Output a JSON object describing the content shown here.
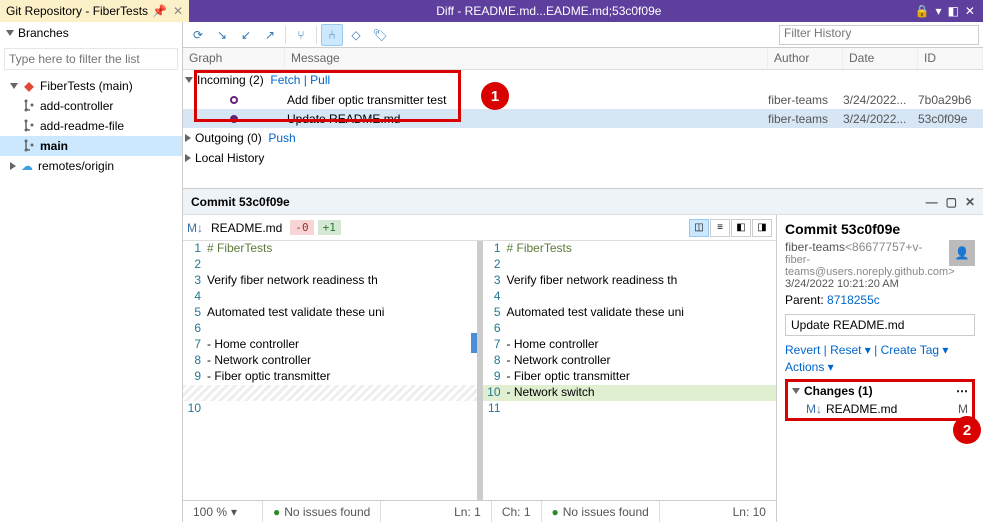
{
  "tab": {
    "title": "Git Repository - FiberTests"
  },
  "window": {
    "diff_title": "Diff - README.md...EADME.md;53c0f09e"
  },
  "branches": {
    "header": "Branches",
    "filter_placeholder": "Type here to filter the list",
    "repo": "FiberTests (main)",
    "items": [
      "add-controller",
      "add-readme-file",
      "main"
    ],
    "remote": "remotes/origin"
  },
  "history": {
    "filter_placeholder": "Filter History",
    "cols": {
      "graph": "Graph",
      "msg": "Message",
      "auth": "Author",
      "date": "Date",
      "id": "ID"
    },
    "incoming_label": "Incoming (2)",
    "incoming_links": "Fetch | Pull",
    "outgoing_label": "Outgoing (0)",
    "outgoing_link": "Push",
    "local_label": "Local History",
    "rows": [
      {
        "msg": "Add fiber optic transmitter test",
        "auth": "fiber-teams",
        "date": "3/24/2022...",
        "id": "7b0a29b6"
      },
      {
        "msg": "Update README.md",
        "auth": "fiber-teams",
        "date": "3/24/2022...",
        "id": "53c0f09e"
      }
    ]
  },
  "detail": {
    "header": "Commit 53c0f09e",
    "file": "README.md",
    "removed": "-0",
    "added": "+1",
    "left_lines": [
      "# FiberTests",
      "",
      "Verify fiber network readiness th",
      "",
      "Automated test validate these uni",
      "",
      "- Home controller",
      "- Network controller",
      "- Fiber optic transmitter"
    ],
    "right_lines": [
      "# FiberTests",
      "",
      "Verify fiber network readiness th",
      "",
      "Automated test validate these uni",
      "",
      "- Home controller",
      "- Network controller",
      "- Fiber optic transmitter",
      "- Network switch"
    ]
  },
  "commit": {
    "title": "Commit 53c0f09e",
    "author": "fiber-teams",
    "author_suffix": "<86677757+v-",
    "email": "fiber-teams@users.noreply.github.com>",
    "timestamp": "3/24/2022 10:21:20 AM",
    "parent_label": "Parent:",
    "parent_sha": "8718255c",
    "message": "Update README.md",
    "actions1": "Revert | Reset ▾ | Create Tag ▾",
    "actions2": "Actions ▾",
    "changes_header": "Changes (1)",
    "changed_file": "README.md",
    "changed_mark": "M"
  },
  "status": {
    "zoom": "100 %",
    "issues": "No issues found",
    "ln": "Ln: 1",
    "ch": "Ch: 1",
    "issues2": "No issues found",
    "ln2": "Ln: 10"
  },
  "callouts": {
    "c1": "1",
    "c2": "2"
  }
}
